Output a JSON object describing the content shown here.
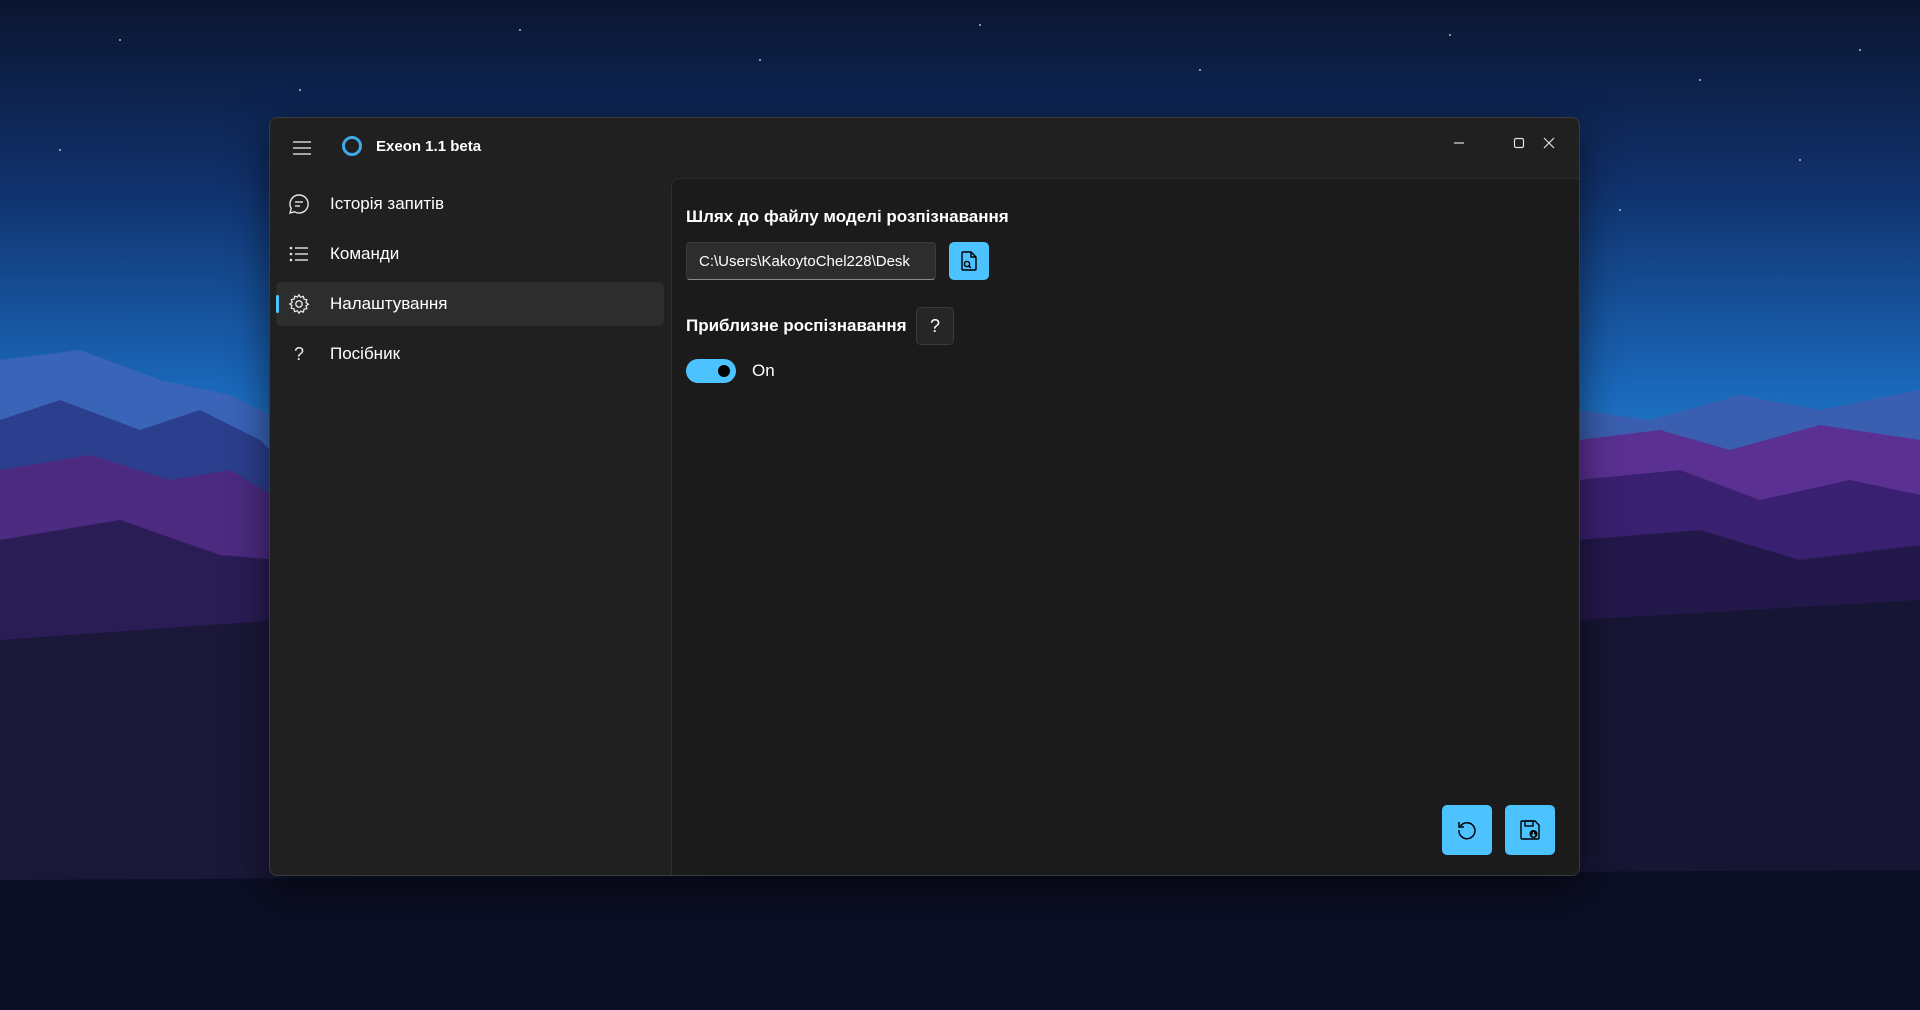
{
  "app": {
    "title": "Exeon 1.1 beta",
    "accent_color": "#4cc2ff",
    "logo_color": "#3fa9e8"
  },
  "titlebar": {
    "menu_icon": "hamburger-menu-icon",
    "minimize_icon": "minimize-icon",
    "maximize_icon": "maximize-icon",
    "close_icon": "close-icon"
  },
  "sidebar": {
    "items": [
      {
        "label": "Історія запитів",
        "icon": "chat-bubble-icon",
        "selected": false
      },
      {
        "label": "Команди",
        "icon": "list-icon",
        "selected": false
      },
      {
        "label": "Налаштування",
        "icon": "gear-icon",
        "selected": true
      },
      {
        "label": "Посібник",
        "icon": "question-icon",
        "selected": false
      }
    ]
  },
  "settings": {
    "model_path": {
      "title": "Шлях до файлу моделі розпізнавання",
      "value": "C:\\Users\\KakoytoChel228\\Desk",
      "browse_icon": "file-search-icon"
    },
    "approx_recognition": {
      "title": "Приблизне роспізнавання",
      "help_label": "?",
      "toggle_on": true,
      "toggle_label": "On"
    }
  },
  "actions": {
    "reset_icon": "reset-icon",
    "save_icon": "save-icon"
  }
}
